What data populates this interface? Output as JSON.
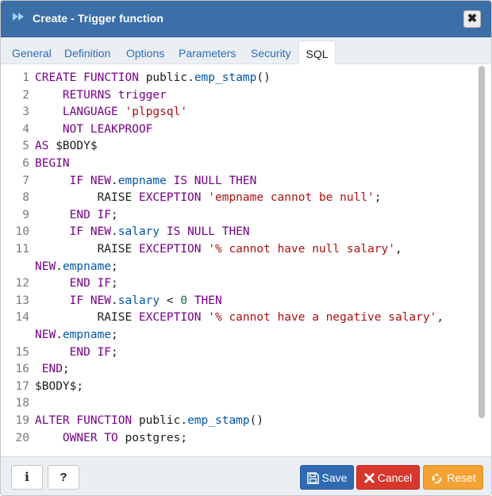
{
  "dialog": {
    "title": "Create - Trigger function",
    "close_label": "✖"
  },
  "tabs": [
    {
      "label": "General",
      "active": false
    },
    {
      "label": "Definition",
      "active": false
    },
    {
      "label": "Options",
      "active": false
    },
    {
      "label": "Parameters",
      "active": false
    },
    {
      "label": "Security",
      "active": false
    },
    {
      "label": "SQL",
      "active": true
    }
  ],
  "editor": {
    "line_numbers": [
      "1",
      "2",
      "3",
      "4",
      "5",
      "6",
      "7",
      "8",
      "9",
      "10",
      "11",
      "",
      "12",
      "13",
      "14",
      "",
      "15",
      "16",
      "17",
      "18",
      "19",
      "20"
    ],
    "lines": [
      [
        {
          "t": "CREATE FUNCTION ",
          "c": "kw"
        },
        {
          "t": "public",
          "c": ""
        },
        {
          "t": ".",
          "c": ""
        },
        {
          "t": "emp_stamp",
          "c": "var"
        },
        {
          "t": "()",
          "c": ""
        }
      ],
      [
        {
          "t": "    RETURNS trigger",
          "c": "kw"
        }
      ],
      [
        {
          "t": "    LANGUAGE ",
          "c": "kw"
        },
        {
          "t": "'plpgsql'",
          "c": "str"
        }
      ],
      [
        {
          "t": "    NOT LEAKPROOF",
          "c": "kw"
        }
      ],
      [
        {
          "t": "AS ",
          "c": "kw"
        },
        {
          "t": "$BODY$",
          "c": ""
        }
      ],
      [
        {
          "t": "BEGIN",
          "c": "kw"
        }
      ],
      [
        {
          "t": "     IF NEW",
          "c": "kw"
        },
        {
          "t": ".",
          "c": ""
        },
        {
          "t": "empname",
          "c": "var"
        },
        {
          "t": " IS NULL THEN",
          "c": "kw"
        }
      ],
      [
        {
          "t": "         RAISE ",
          "c": ""
        },
        {
          "t": "EXCEPTION ",
          "c": "kw"
        },
        {
          "t": "'empname cannot be null'",
          "c": "str"
        },
        {
          "t": ";",
          "c": ""
        }
      ],
      [
        {
          "t": "     END IF",
          "c": "kw"
        },
        {
          "t": ";",
          "c": ""
        }
      ],
      [
        {
          "t": "     IF NEW",
          "c": "kw"
        },
        {
          "t": ".",
          "c": ""
        },
        {
          "t": "salary",
          "c": "var"
        },
        {
          "t": " IS NULL THEN",
          "c": "kw"
        }
      ],
      [
        {
          "t": "         RAISE ",
          "c": ""
        },
        {
          "t": "EXCEPTION ",
          "c": "kw"
        },
        {
          "t": "'% cannot have null salary'",
          "c": "str"
        },
        {
          "t": ",",
          "c": ""
        }
      ],
      [
        {
          "t": "NEW",
          "c": "kw"
        },
        {
          "t": ".",
          "c": ""
        },
        {
          "t": "empname",
          "c": "var"
        },
        {
          "t": ";",
          "c": ""
        }
      ],
      [
        {
          "t": "     END IF",
          "c": "kw"
        },
        {
          "t": ";",
          "c": ""
        }
      ],
      [
        {
          "t": "     IF NEW",
          "c": "kw"
        },
        {
          "t": ".",
          "c": ""
        },
        {
          "t": "salary",
          "c": "var"
        },
        {
          "t": " < ",
          "c": ""
        },
        {
          "t": "0",
          "c": "num"
        },
        {
          "t": " THEN",
          "c": "kw"
        }
      ],
      [
        {
          "t": "         RAISE ",
          "c": ""
        },
        {
          "t": "EXCEPTION ",
          "c": "kw"
        },
        {
          "t": "'% cannot have a negative salary'",
          "c": "str"
        },
        {
          "t": ",",
          "c": ""
        }
      ],
      [
        {
          "t": "NEW",
          "c": "kw"
        },
        {
          "t": ".",
          "c": ""
        },
        {
          "t": "empname",
          "c": "var"
        },
        {
          "t": ";",
          "c": ""
        }
      ],
      [
        {
          "t": "     END IF",
          "c": "kw"
        },
        {
          "t": ";",
          "c": ""
        }
      ],
      [
        {
          "t": " END",
          "c": "kw"
        },
        {
          "t": ";",
          "c": ""
        }
      ],
      [
        {
          "t": "$BODY$",
          "c": ""
        },
        {
          "t": ";",
          "c": ""
        }
      ],
      [
        {
          "t": "",
          "c": ""
        }
      ],
      [
        {
          "t": "ALTER FUNCTION ",
          "c": "kw"
        },
        {
          "t": "public",
          "c": ""
        },
        {
          "t": ".",
          "c": ""
        },
        {
          "t": "emp_stamp",
          "c": "var"
        },
        {
          "t": "()",
          "c": ""
        }
      ],
      [
        {
          "t": "    OWNER TO ",
          "c": "kw"
        },
        {
          "t": "postgres",
          "c": ""
        },
        {
          "t": ";",
          "c": ""
        }
      ]
    ]
  },
  "footer": {
    "info_label": "i",
    "help_label": "?",
    "save_label": "Save",
    "cancel_label": "Cancel",
    "reset_label": "Reset"
  },
  "icons": {
    "title": "fast-forward-icon",
    "save": "floppy-disk-icon",
    "cancel": "x-icon",
    "reset": "recycle-icon"
  },
  "colors": {
    "titlebar": "#3c6fa8",
    "save": "#2f6ab3",
    "cancel": "#d9372e",
    "reset": "#f3a233"
  }
}
